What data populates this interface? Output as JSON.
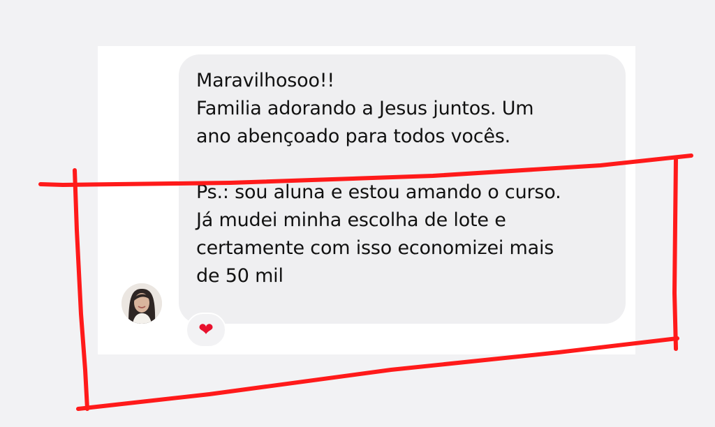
{
  "message": {
    "paragraph1": [
      "Maravilhosoo!!",
      "Familia adorando a Jesus juntos. Um",
      "ano abençoado para todos vocês."
    ],
    "paragraph2": [
      "Ps.: sou aluna e estou amando o curso.",
      "Já mudei minha escolha de lote e",
      "certamente com isso economizei mais",
      "de 50 mil"
    ]
  },
  "reaction": {
    "emoji": "❤",
    "icon": "heart-icon"
  },
  "annotation": {
    "color": "#ff1a1a"
  },
  "colors": {
    "bubble": "#efeff1",
    "text": "#111111",
    "background": "#f2f2f4"
  }
}
